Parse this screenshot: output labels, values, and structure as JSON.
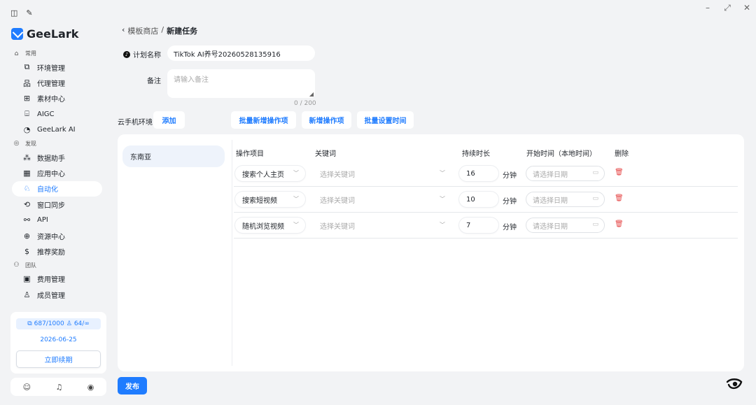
{
  "window": {
    "minimize": "–",
    "restore": "⤢",
    "close": "✕"
  },
  "sidebar": {
    "logo": "GeeLark",
    "groups": [
      {
        "label": "常用",
        "items": [
          "环境管理",
          "代理管理",
          "素材中心",
          "AIGC",
          "GeeLark AI"
        ]
      },
      {
        "label": "发现",
        "items": [
          "数据助手",
          "应用中心",
          "自动化",
          "窗口同步",
          "API",
          "资源中心",
          "推荐奖励"
        ]
      },
      {
        "label": "团队",
        "items": [
          "费用管理",
          "成员管理"
        ]
      }
    ],
    "active_item": "自动化",
    "quota": {
      "devices": "687/1000",
      "members": "64/∞",
      "date": "2026-06-25",
      "renew_label": "立即续期"
    }
  },
  "breadcrumb": {
    "parent": "模板商店",
    "separator": "/",
    "current": "新建任务"
  },
  "form": {
    "plan_label": "计划名称",
    "plan_value": "TikTok AI养号20260528135916",
    "note_label": "备注",
    "note_placeholder": "请输入备注",
    "note_count": "0 / 200",
    "env_label": "云手机环境",
    "add_label": "添加",
    "bulk_add_label": "批量新增操作项",
    "add_op_label": "新增操作项",
    "bulk_time_label": "批量设置时间"
  },
  "panel": {
    "region": "东南亚",
    "headers": {
      "op": "操作项目",
      "keyword": "关键词",
      "duration": "持续时长",
      "start": "开始时间（本地时间）",
      "delete": "删除"
    },
    "rows": [
      {
        "op": "搜索个人主页",
        "keyword_placeholder": "选择关键词",
        "duration": "16",
        "unit": "分钟",
        "date_placeholder": "请选择日期"
      },
      {
        "op": "搜索短视频",
        "keyword_placeholder": "选择关键词",
        "duration": "10",
        "unit": "分钟",
        "date_placeholder": "请选择日期"
      },
      {
        "op": "随机浏览视频",
        "keyword_placeholder": "选择关键词",
        "duration": "7",
        "unit": "分钟",
        "date_placeholder": "请选择日期"
      }
    ]
  },
  "publish_label": "发布",
  "colors": {
    "accent": "#1f7cff",
    "danger": "#e54545"
  }
}
